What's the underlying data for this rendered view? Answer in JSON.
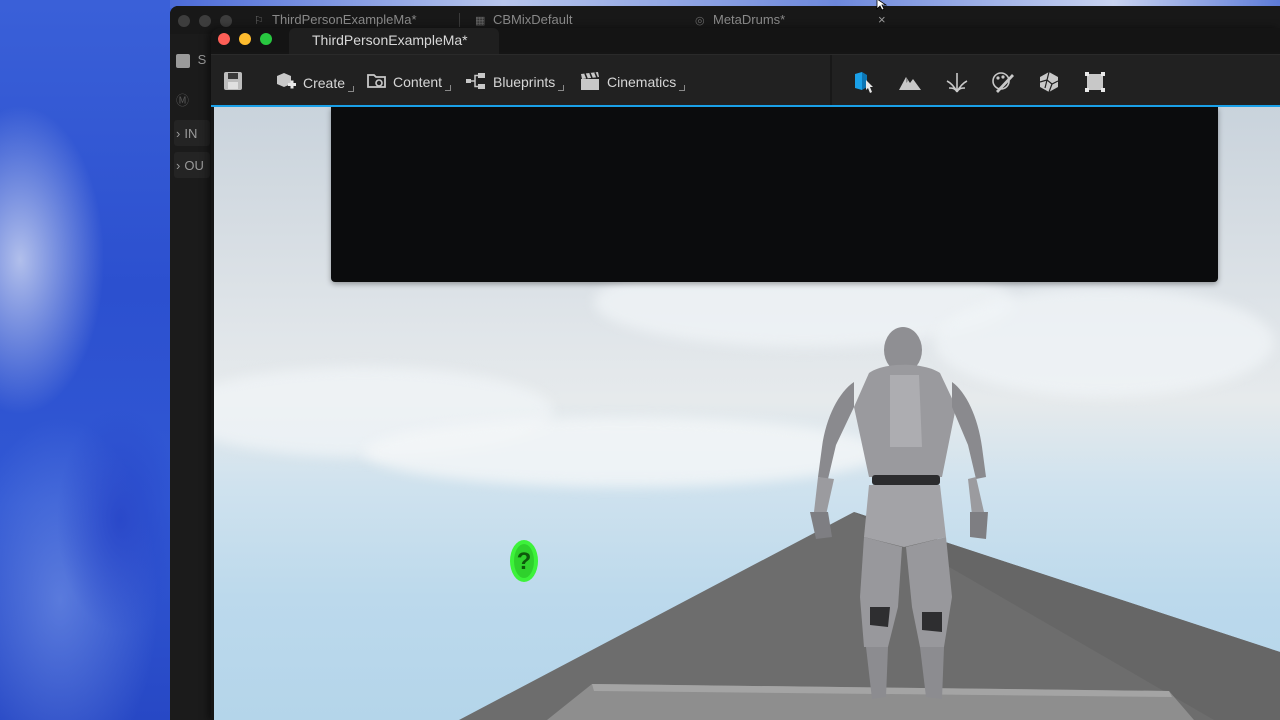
{
  "background_window": {
    "tabs": [
      {
        "label": "ThirdPersonExampleMa*",
        "icon": "level-icon"
      },
      {
        "label": "CBMixDefault",
        "icon": "asset-icon"
      },
      {
        "label": "MetaDrums*",
        "icon": "metasound-icon"
      }
    ],
    "close_glyph": "×",
    "side_rows": [
      {
        "label": "S",
        "icon": "save-icon"
      },
      {
        "label": "IN",
        "icon": "chevron-right-icon"
      },
      {
        "label": "OU",
        "icon": "chevron-right-icon"
      }
    ]
  },
  "window": {
    "title": "ThirdPersonExampleMa*"
  },
  "toolbar": {
    "create_label": "Create",
    "content_label": "Content",
    "blueprints_label": "Blueprints",
    "cinematics_label": "Cinematics",
    "modes": [
      {
        "name": "select-mode-icon",
        "active": true
      },
      {
        "name": "landscape-mode-icon",
        "active": false
      },
      {
        "name": "foliage-mode-icon",
        "active": false
      },
      {
        "name": "mesh-paint-mode-icon",
        "active": false
      },
      {
        "name": "fracture-mode-icon",
        "active": false
      },
      {
        "name": "brush-edit-mode-icon",
        "active": false
      }
    ]
  },
  "colors": {
    "accent": "#1aa0e8",
    "close_red": "#fe5f57",
    "minimize_yellow": "#febc2e",
    "zoom_green": "#28c840",
    "question_marker": "#3df23a"
  },
  "viewport": {
    "question_marker_glyph": "?"
  }
}
